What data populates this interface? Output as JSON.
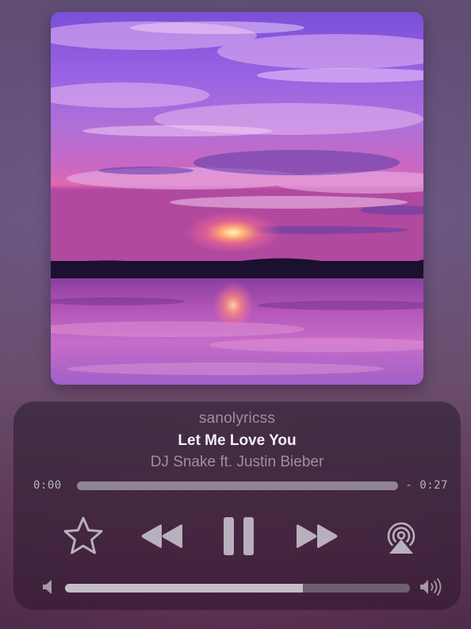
{
  "colors": {
    "control_gray": "#b9b0bd",
    "title_white": "#f4eff5",
    "subtle_text": "#9b919f"
  },
  "artwork": {
    "icon": "album-art-sunset-lake"
  },
  "now_playing": {
    "account": "sanolyricss",
    "title": "Let Me Love You",
    "artist": "DJ Snake ft. Justin Bieber"
  },
  "progress": {
    "elapsed": "0:00",
    "remaining": "- 0:27",
    "fraction": 0.0
  },
  "controls": {
    "favorite_icon": "star-outline-icon",
    "rewind_icon": "rewind-icon",
    "pause_icon": "pause-icon",
    "forward_icon": "fast-forward-icon",
    "airplay_icon": "airplay-icon"
  },
  "volume": {
    "level": 0.69,
    "low_icon": "volume-low-icon",
    "high_icon": "volume-high-icon"
  }
}
